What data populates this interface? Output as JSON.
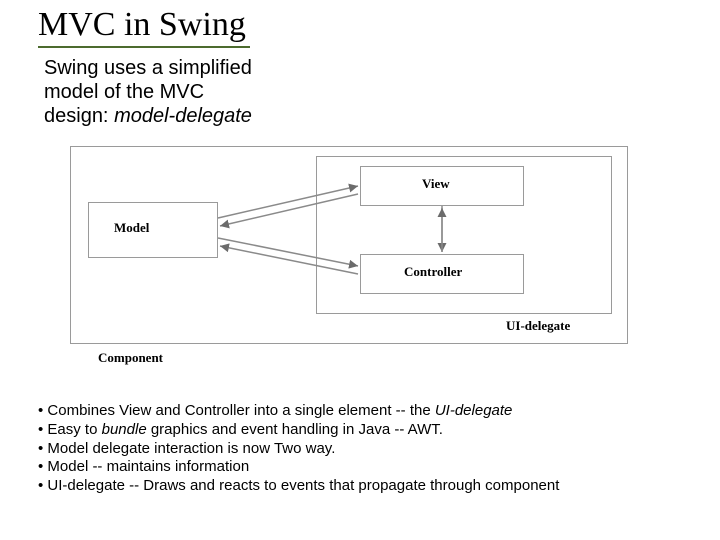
{
  "title": "MVC in Swing",
  "intro": {
    "line1": "Swing uses a simplified",
    "line2": "model of the MVC",
    "line3_a": "design: ",
    "line3_b": "model-delegate"
  },
  "diagram": {
    "component": "Component",
    "model": "Model",
    "uidelegate": "UI-delegate",
    "view": "View",
    "controller": "Controller"
  },
  "bullets": {
    "b1_a": "• Combines View and Controller into a single element -- the ",
    "b1_b": "UI-delegate",
    "b2_a": "• Easy to ",
    "b2_b": "bundle",
    "b2_c": " graphics and event handling in Java -- AWT.",
    "b3": "• Model delegate interaction is now Two way.",
    "b4": "• Model -- maintains information",
    "b5": "• UI-delegate -- Draws and reacts to events that propagate through component"
  }
}
